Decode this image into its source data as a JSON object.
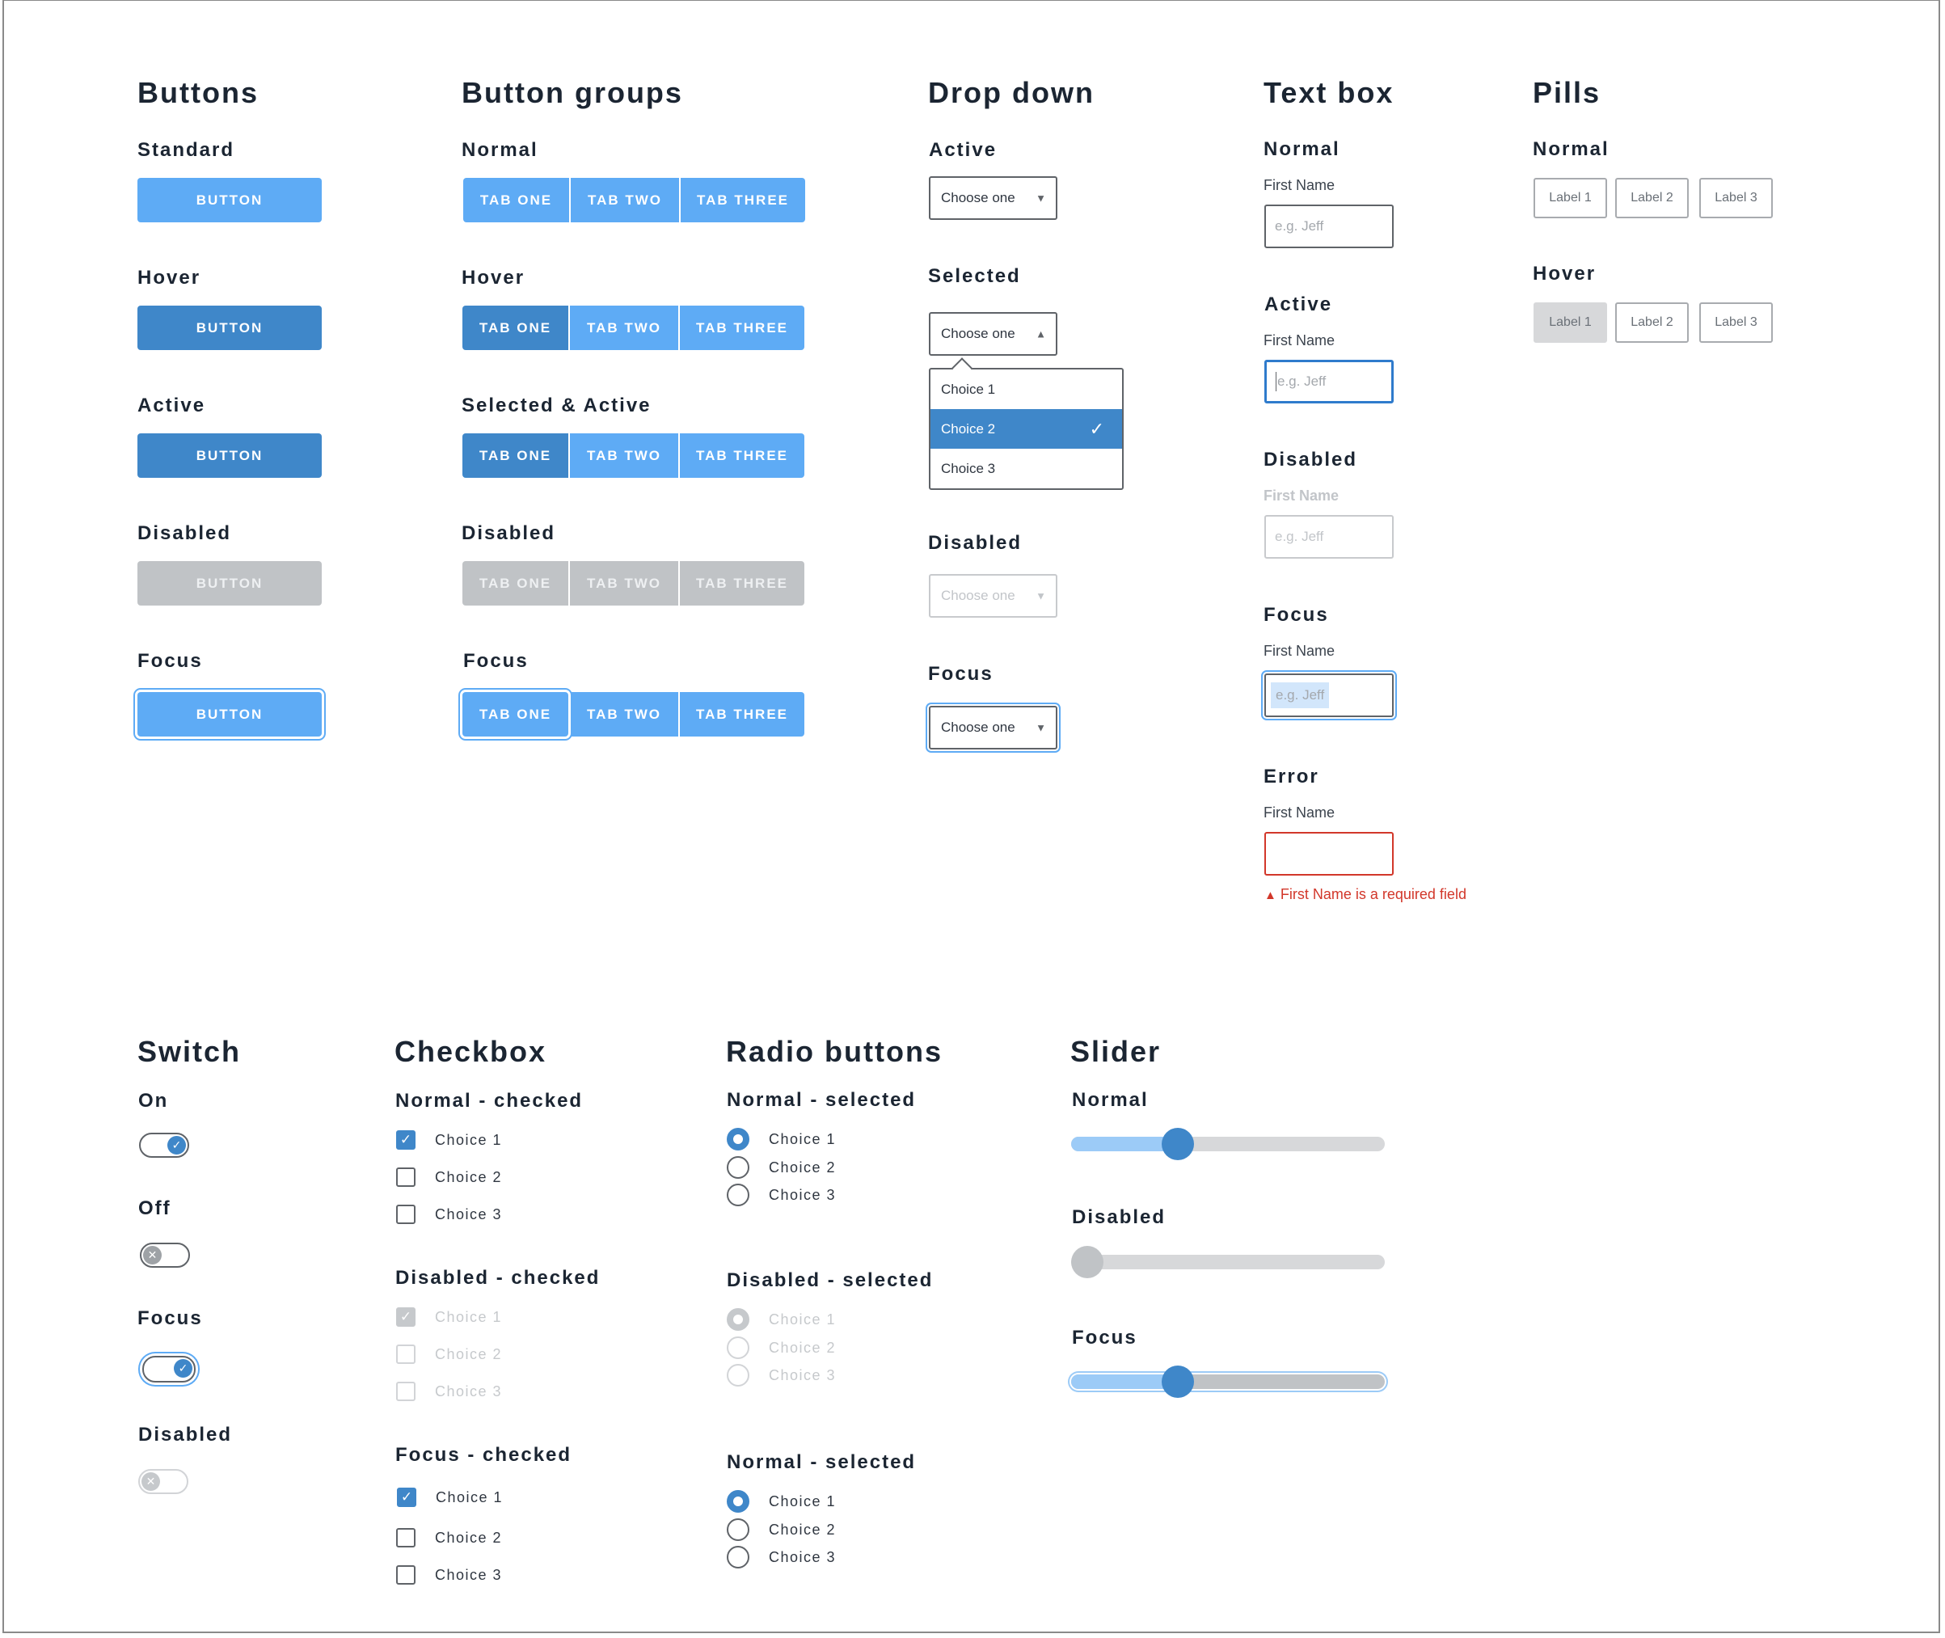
{
  "buttons": {
    "title": "Buttons",
    "states": [
      {
        "label": "Standard",
        "button": "BUTTON"
      },
      {
        "label": "Hover",
        "button": "BUTTON"
      },
      {
        "label": "Active",
        "button": "BUTTON"
      },
      {
        "label": "Disabled",
        "button": "BUTTON"
      },
      {
        "label": "Focus",
        "button": "BUTTON"
      }
    ]
  },
  "button_groups": {
    "title": "Button groups",
    "tabs": [
      "TAB ONE",
      "TAB TWO",
      "TAB THREE"
    ],
    "states": [
      {
        "label": "Normal"
      },
      {
        "label": "Hover"
      },
      {
        "label": "Selected & Active"
      },
      {
        "label": "Disabled"
      },
      {
        "label": "Focus"
      }
    ]
  },
  "dropdown": {
    "title": "Drop down",
    "placeholder": "Choose one",
    "options": [
      "Choice 1",
      "Choice 2",
      "Choice 3"
    ],
    "selected_option": "Choice 2",
    "states": [
      {
        "label": "Active"
      },
      {
        "label": "Selected"
      },
      {
        "label": "Disabled"
      },
      {
        "label": "Focus"
      }
    ]
  },
  "textbox": {
    "title": "Text box",
    "field_label": "First Name",
    "placeholder": "e.g. Jeff",
    "error_message": "First Name is a required field",
    "states": [
      {
        "label": "Normal"
      },
      {
        "label": "Active"
      },
      {
        "label": "Disabled"
      },
      {
        "label": "Focus"
      },
      {
        "label": "Error"
      }
    ]
  },
  "pills": {
    "title": "Pills",
    "labels": [
      "Label 1",
      "Label 2",
      "Label 3"
    ],
    "states": [
      {
        "label": "Normal"
      },
      {
        "label": "Hover"
      }
    ]
  },
  "switch": {
    "title": "Switch",
    "states": [
      {
        "label": "On",
        "on": true
      },
      {
        "label": "Off",
        "on": false
      },
      {
        "label": "Focus",
        "on": true
      },
      {
        "label": "Disabled",
        "on": false
      }
    ]
  },
  "checkbox": {
    "title": "Checkbox",
    "choices": [
      "Choice 1",
      "Choice 2",
      "Choice 3"
    ],
    "groups": [
      {
        "label": "Normal - checked",
        "checked": [
          true,
          false,
          false
        ]
      },
      {
        "label": "Disabled - checked",
        "checked": [
          true,
          false,
          false
        ]
      },
      {
        "label": "Focus - checked",
        "checked": [
          true,
          false,
          false
        ]
      }
    ]
  },
  "radio": {
    "title": "Radio buttons",
    "choices": [
      "Choice 1",
      "Choice 2",
      "Choice 3"
    ],
    "groups": [
      {
        "label": "Normal - selected",
        "selected": "Choice 1"
      },
      {
        "label": "Disabled - selected",
        "selected": "Choice 1"
      },
      {
        "label": "Normal - selected",
        "selected": "Choice 1"
      }
    ]
  },
  "slider": {
    "title": "Slider",
    "states": [
      {
        "label": "Normal",
        "value_percent": 34
      },
      {
        "label": "Disabled",
        "value_percent": 0
      },
      {
        "label": "Focus",
        "value_percent": 34
      }
    ]
  },
  "icons": {
    "caret_down": "▼",
    "caret_up": "▲",
    "check": "✓",
    "cross": "✕",
    "warning": "▲"
  },
  "colors": {
    "primary": "#5eabf5",
    "primary_dark": "#3f87c9",
    "disabled": "#c0c3c6",
    "error": "#d2372a",
    "text": "#1b2532"
  }
}
